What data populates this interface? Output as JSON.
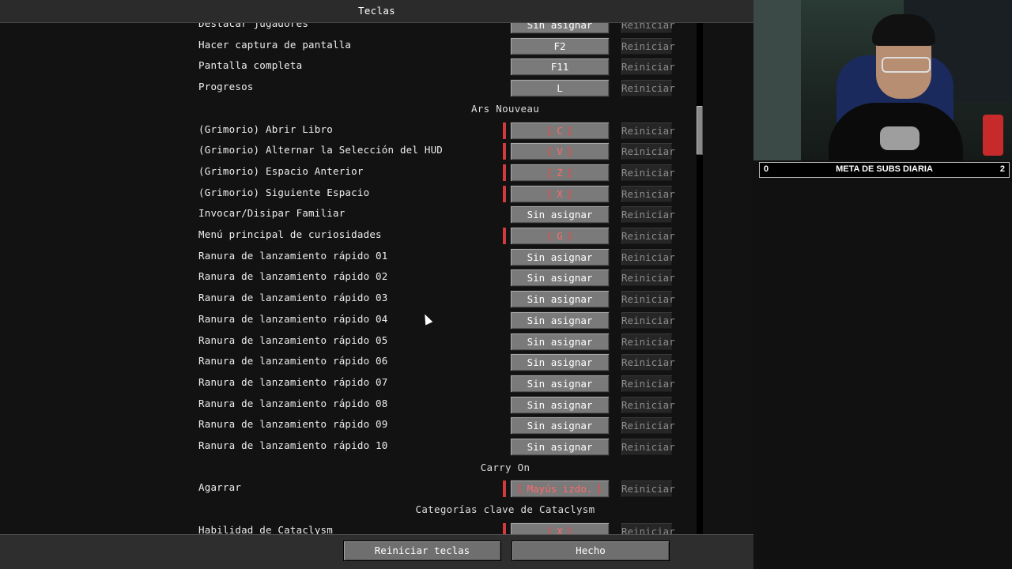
{
  "window": {
    "title": "Teclas"
  },
  "rows": [
    {
      "type": "bind",
      "label": "Destacar jugadores",
      "key": "Sin asignar",
      "conflict": false,
      "reset": "Reiniciar"
    },
    {
      "type": "bind",
      "label": "Hacer captura de pantalla",
      "key": "F2",
      "conflict": false,
      "reset": "Reiniciar"
    },
    {
      "type": "bind",
      "label": "Pantalla completa",
      "key": "F11",
      "conflict": false,
      "reset": "Reiniciar"
    },
    {
      "type": "bind",
      "label": "Progresos",
      "key": "L",
      "conflict": false,
      "reset": "Reiniciar"
    },
    {
      "type": "category",
      "label": "Ars Nouveau"
    },
    {
      "type": "bind",
      "label": "(Grimorio) Abrir Libro",
      "key": "C",
      "conflict": true,
      "reset": "Reiniciar"
    },
    {
      "type": "bind",
      "label": "(Grimorio) Alternar la Selección del HUD",
      "key": "V",
      "conflict": true,
      "reset": "Reiniciar"
    },
    {
      "type": "bind",
      "label": "(Grimorio) Espacio Anterior",
      "key": "Z",
      "conflict": true,
      "reset": "Reiniciar"
    },
    {
      "type": "bind",
      "label": "(Grimorio) Siguiente Espacio",
      "key": "X",
      "conflict": true,
      "reset": "Reiniciar"
    },
    {
      "type": "bind",
      "label": "Invocar/Disipar Familiar",
      "key": "Sin asignar",
      "conflict": false,
      "reset": "Reiniciar"
    },
    {
      "type": "bind",
      "label": "Menú principal de curiosidades",
      "key": "G",
      "conflict": true,
      "reset": "Reiniciar"
    },
    {
      "type": "bind",
      "label": "Ranura de lanzamiento rápido 01",
      "key": "Sin asignar",
      "conflict": false,
      "reset": "Reiniciar"
    },
    {
      "type": "bind",
      "label": "Ranura de lanzamiento rápido 02",
      "key": "Sin asignar",
      "conflict": false,
      "reset": "Reiniciar"
    },
    {
      "type": "bind",
      "label": "Ranura de lanzamiento rápido 03",
      "key": "Sin asignar",
      "conflict": false,
      "reset": "Reiniciar"
    },
    {
      "type": "bind",
      "label": "Ranura de lanzamiento rápido 04",
      "key": "Sin asignar",
      "conflict": false,
      "reset": "Reiniciar"
    },
    {
      "type": "bind",
      "label": "Ranura de lanzamiento rápido 05",
      "key": "Sin asignar",
      "conflict": false,
      "reset": "Reiniciar"
    },
    {
      "type": "bind",
      "label": "Ranura de lanzamiento rápido 06",
      "key": "Sin asignar",
      "conflict": false,
      "reset": "Reiniciar"
    },
    {
      "type": "bind",
      "label": "Ranura de lanzamiento rápido 07",
      "key": "Sin asignar",
      "conflict": false,
      "reset": "Reiniciar"
    },
    {
      "type": "bind",
      "label": "Ranura de lanzamiento rápido 08",
      "key": "Sin asignar",
      "conflict": false,
      "reset": "Reiniciar"
    },
    {
      "type": "bind",
      "label": "Ranura de lanzamiento rápido 09",
      "key": "Sin asignar",
      "conflict": false,
      "reset": "Reiniciar"
    },
    {
      "type": "bind",
      "label": "Ranura de lanzamiento rápido 10",
      "key": "Sin asignar",
      "conflict": false,
      "reset": "Reiniciar"
    },
    {
      "type": "category",
      "label": "Carry On"
    },
    {
      "type": "bind",
      "label": "Agarrar",
      "key": "Mayús izdo.",
      "conflict": true,
      "reset": "Reiniciar"
    },
    {
      "type": "category",
      "label": "Categorías clave de Cataclysm"
    },
    {
      "type": "bind",
      "label": "Habilidad de Cataclysm",
      "key": "X",
      "conflict": true,
      "reset": "Reiniciar"
    }
  ],
  "footer": {
    "reset_keys_label": "Reiniciar teclas",
    "done_label": "Hecho"
  },
  "overlay": {
    "goal_left": "0",
    "goal_title": "META DE SUBS DIARIA",
    "goal_right": "2"
  },
  "colors": {
    "conflict": "#d23b3b",
    "bracket": "#ff4040"
  }
}
